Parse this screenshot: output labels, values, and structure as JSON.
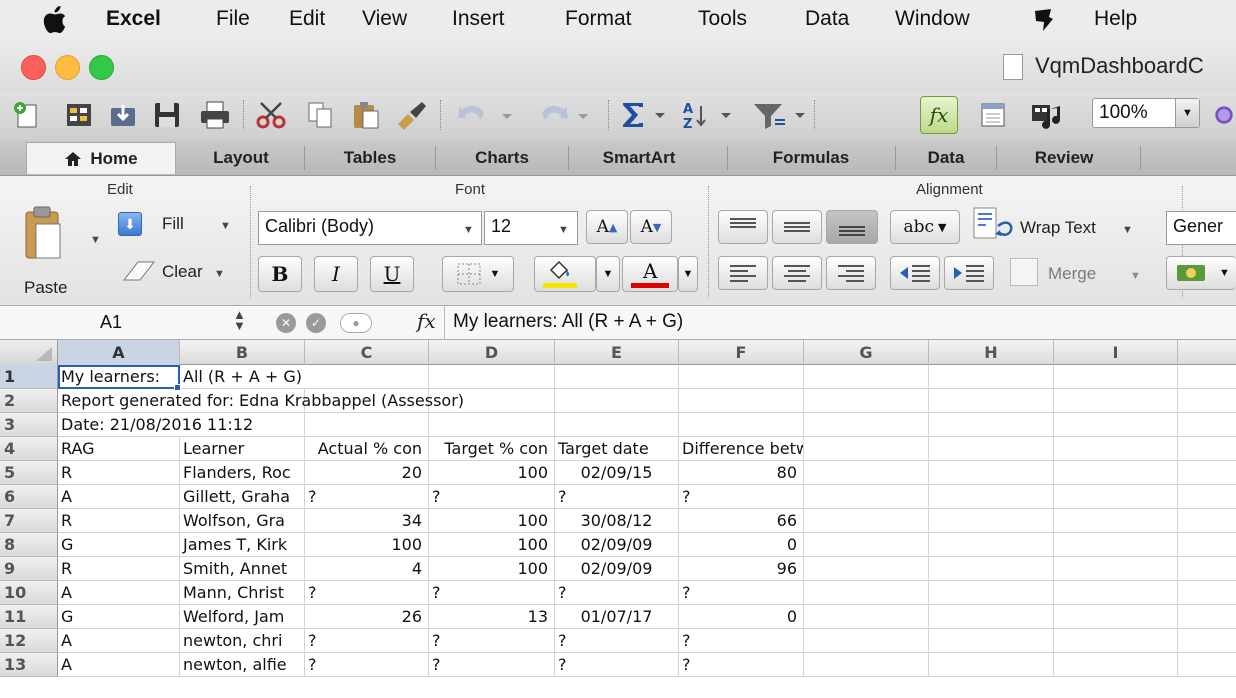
{
  "menubar": {
    "app": "Excel",
    "items": [
      "File",
      "Edit",
      "View",
      "Insert",
      "Format",
      "Tools",
      "Data",
      "Window",
      "Help"
    ]
  },
  "window": {
    "title": "VqmDashboardC"
  },
  "toolbar": {
    "zoom": "100%"
  },
  "ribbon_tabs": [
    "Home",
    "Layout",
    "Tables",
    "Charts",
    "SmartArt",
    "Formulas",
    "Data",
    "Review"
  ],
  "ribbon": {
    "groups": {
      "edit": "Edit",
      "font": "Font",
      "alignment": "Alignment"
    },
    "paste_label": "Paste",
    "fill_label": "Fill",
    "clear_label": "Clear",
    "font_name": "Calibri (Body)",
    "font_size": "12",
    "grow_font": "A",
    "shrink_font": "A",
    "bold": "B",
    "italic": "I",
    "underline": "U",
    "font_color_glyph": "A",
    "orientation_label": "abc",
    "wrap_text": "Wrap Text",
    "merge": "Merge",
    "number_format": "Gener",
    "highlight_color": "#f5e600",
    "font_color": "#e00000"
  },
  "formula_bar": {
    "name_box": "A1",
    "fx": "fx",
    "formula": "My learners: All (R + A + G)"
  },
  "sheet": {
    "columns": [
      "A",
      "B",
      "C",
      "D",
      "E",
      "F",
      "G",
      "H",
      "I"
    ],
    "rows": [
      {
        "n": "1",
        "A": "My learners:",
        "B": "All (R + A + G)"
      },
      {
        "n": "2",
        "A": "Report generated for: Edna Krabbappel (Assessor)"
      },
      {
        "n": "3",
        "A": "Date: 21/08/2016 11:12"
      },
      {
        "n": "4",
        "A": "RAG",
        "B": "Learner",
        "C": "Actual % con",
        "D": "Target % con",
        "E": "Target date",
        "F": "Difference between actual and target %"
      },
      {
        "n": "5",
        "A": "R",
        "B": "Flanders, Roc",
        "C": "20",
        "D": "100",
        "E": "02/09/15",
        "F": "80"
      },
      {
        "n": "6",
        "A": "A",
        "B": "Gillett, Graha",
        "C": "?",
        "D": "?",
        "E": "?",
        "F": "?"
      },
      {
        "n": "7",
        "A": "R",
        "B": "Wolfson, Gra",
        "C": "34",
        "D": "100",
        "E": "30/08/12",
        "F": "66"
      },
      {
        "n": "8",
        "A": "G",
        "B": "James T, Kirk",
        "C": "100",
        "D": "100",
        "E": "02/09/09",
        "F": "0"
      },
      {
        "n": "9",
        "A": "R",
        "B": "Smith, Annet",
        "C": "4",
        "D": "100",
        "E": "02/09/09",
        "F": "96"
      },
      {
        "n": "10",
        "A": "A",
        "B": "Mann, Christ",
        "C": "?",
        "D": "?",
        "E": "?",
        "F": "?"
      },
      {
        "n": "11",
        "A": "G",
        "B": "Welford, Jam",
        "C": "26",
        "D": "13",
        "E": "01/07/17",
        "F": "0"
      },
      {
        "n": "12",
        "A": "A",
        "B": "newton, chri",
        "C": "?",
        "D": "?",
        "E": "?",
        "F": "?"
      },
      {
        "n": "13",
        "A": "A",
        "B": "newton, alfie",
        "C": "?",
        "D": "?",
        "E": "?",
        "F": "?"
      }
    ]
  }
}
